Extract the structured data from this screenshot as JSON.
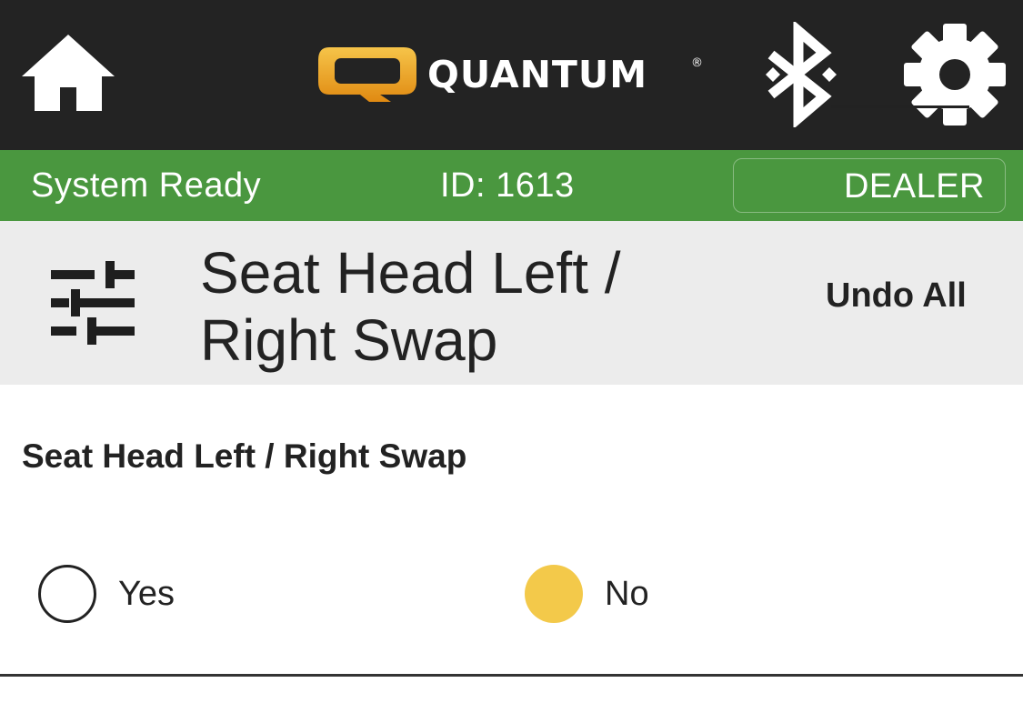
{
  "topbar": {
    "logo_text": "QUANTUM",
    "logo_reg": "®",
    "icons": {
      "home": "home-icon",
      "bluetooth": "bluetooth-icon",
      "settings": "gear-icon"
    },
    "logo_colors": {
      "q_outer": "#f0a928",
      "q_inner": "#232323",
      "text": "#ffffff"
    }
  },
  "status_bar": {
    "status": "System Ready",
    "id": "ID: 1613",
    "mode_button": "DEALER",
    "color": "#4a973f"
  },
  "header": {
    "title": "Seat Head Left / Right Swap",
    "undo_label": "Undo All",
    "icon": "sliders-icon"
  },
  "setting": {
    "label": "Seat Head Left / Right Swap",
    "options": [
      {
        "label": "Yes",
        "selected": false
      },
      {
        "label": "No",
        "selected": true
      }
    ],
    "selected_color": "#f3c94a"
  }
}
